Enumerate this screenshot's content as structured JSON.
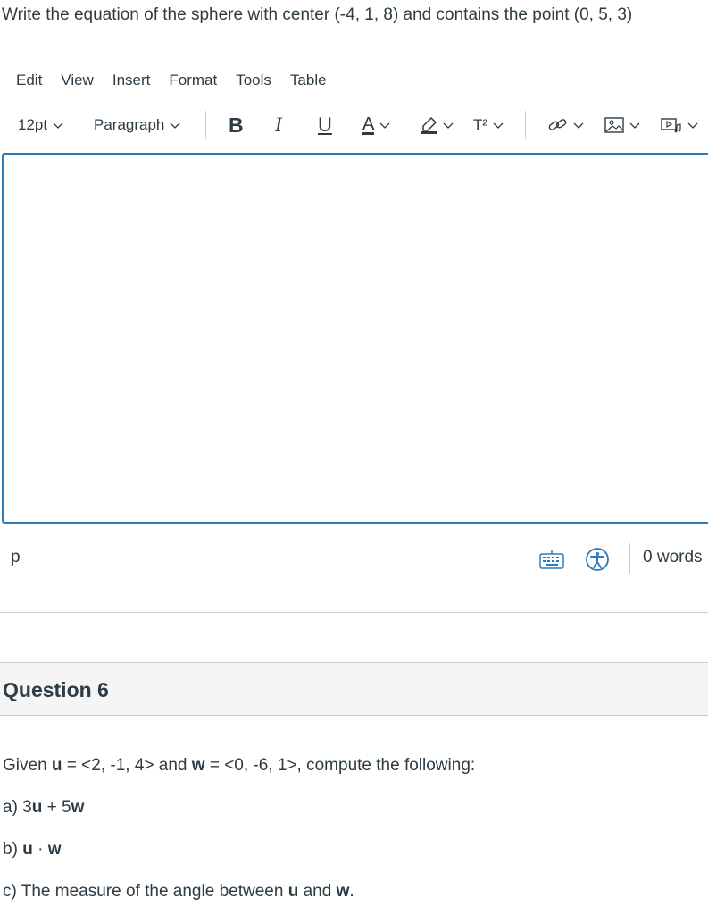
{
  "question5": {
    "prompt": "Write the equation of the sphere with center (-4, 1, 8) and contains the point (0, 5, 3)"
  },
  "menubar": {
    "items": [
      "Edit",
      "View",
      "Insert",
      "Format",
      "Tools",
      "Table"
    ]
  },
  "toolbar": {
    "font_size": "12pt",
    "block_format": "Paragraph",
    "bold": "B",
    "italic": "I",
    "underline": "U",
    "text_color": "A",
    "superscript": "T²",
    "icons": [
      "chevron-down-icon",
      "highlighter-icon",
      "link-icon",
      "image-icon",
      "media-icon"
    ]
  },
  "statusbar": {
    "path": "p",
    "word_count": "0 words",
    "icons": [
      "keyboard-icon",
      "accessibility-icon"
    ]
  },
  "question6": {
    "title": "Question 6",
    "line1": {
      "pre": "Given ",
      "u": "u",
      "mid": " = <2, -1, 4> and ",
      "w": "w",
      "post": " = <0, -6, 1>, compute the following:"
    },
    "line2": {
      "pre": "a) 3",
      "u": "u",
      "mid": " + 5",
      "w": "w"
    },
    "line3": {
      "pre": "b) ",
      "u": "u",
      "dot": " · ",
      "w": "w"
    },
    "line4": {
      "pre": "c) The measure of the angle between ",
      "u": "u",
      "mid": " and ",
      "w": "w",
      "post": "."
    }
  },
  "colors": {
    "text": "#2d3b45",
    "editor_border": "#2b7abc",
    "accent_icon": "#2b7abc",
    "header_bg": "#f5f5f5",
    "divider": "#c7cdd1"
  }
}
